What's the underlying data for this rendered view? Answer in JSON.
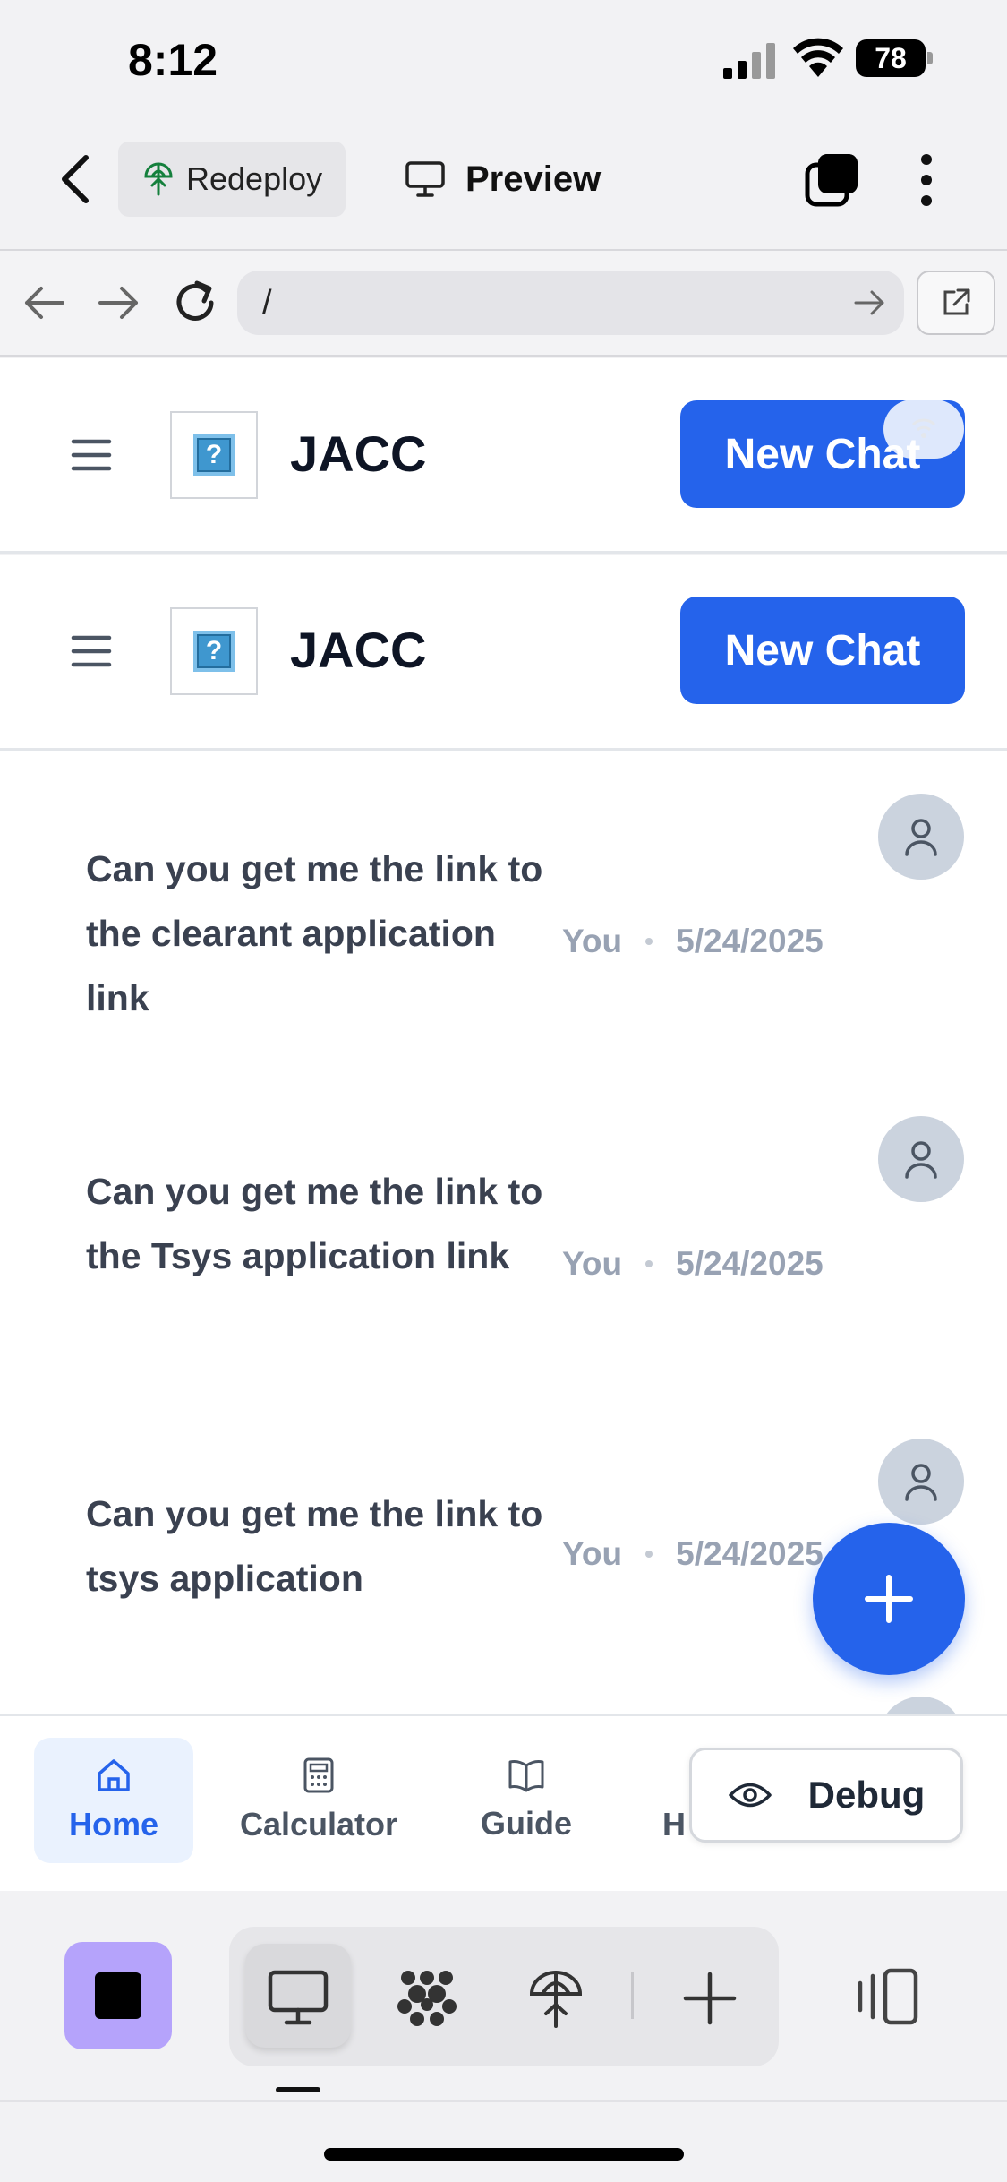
{
  "status_bar": {
    "time": "8:12",
    "battery": "78"
  },
  "toolbar": {
    "redeploy_label": "Redeploy",
    "preview_label": "Preview"
  },
  "url_bar": {
    "url": "/"
  },
  "app_header": {
    "title": "JACC",
    "new_chat_label": "New Chat",
    "logo_glyph": "?"
  },
  "messages": [
    {
      "text": "Can you get me the link to the clearant application link",
      "author": "You",
      "date": "5/24/2025"
    },
    {
      "text": "Can you get me the link to the Tsys application link",
      "author": "You",
      "date": "5/24/2025"
    },
    {
      "text": "Can you get me the link to tsys application",
      "author": "You",
      "date": "5/24/2025"
    }
  ],
  "bottom_nav": {
    "items": [
      {
        "label": "Home",
        "icon": "home-icon",
        "active": true
      },
      {
        "label": "Calculator",
        "icon": "calculator-icon",
        "active": false
      },
      {
        "label": "Guide",
        "icon": "book-icon",
        "active": false
      },
      {
        "label": "H",
        "icon": "unknown",
        "active": false
      }
    ],
    "debug_label": "Debug"
  },
  "colors": {
    "accent": "#2563eb",
    "stop_button": "#b5a3fb",
    "avatar_bg": "#cbd3de"
  }
}
